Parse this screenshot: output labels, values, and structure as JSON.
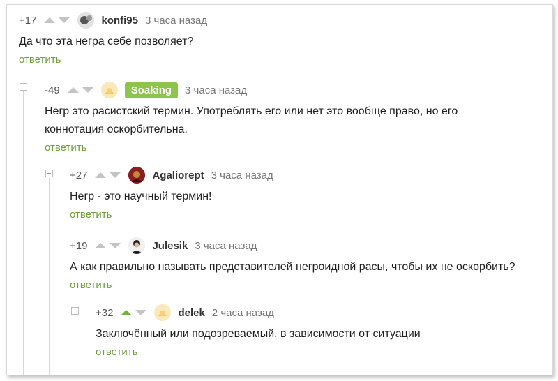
{
  "comments": [
    {
      "rating": "+17",
      "author": "konfi95",
      "time": "3 часа назад",
      "text": "Да что эта негра себе позволяет?",
      "reply": "ответить",
      "upvoted": false
    },
    {
      "rating": "-49",
      "author": "Soaking",
      "time": "3 часа назад",
      "text": "Негр это расистский термин. Употреблять его или нет это вообще право, но его коннотация оскорбительна.",
      "reply": "ответить",
      "upvoted": false
    },
    {
      "rating": "+27",
      "author": "Agaliorept",
      "time": "3 часа назад",
      "text": "Негр - это научный термин!",
      "reply": "ответить",
      "upvoted": false
    },
    {
      "rating": "+19",
      "author": "Julesik",
      "time": "3 часа назад",
      "text": "А как правильно называть представителей негроидной расы, чтобы их не оскорбить?",
      "reply": "ответить",
      "upvoted": false
    },
    {
      "rating": "+32",
      "author": "delek",
      "time": "2 часа назад",
      "text": "Заключённый или подозреваемый, в зависимости от ситуации",
      "reply": "ответить",
      "upvoted": true
    }
  ],
  "colors": {
    "accent": "#6b9e3a",
    "badge": "#8dc44d",
    "vote_inactive": "#c4c4c4",
    "vote_active": "#6fb534"
  },
  "icons": {
    "up": "vote-up-icon",
    "down": "vote-down-icon",
    "collapse": "collapse-branch-icon"
  }
}
